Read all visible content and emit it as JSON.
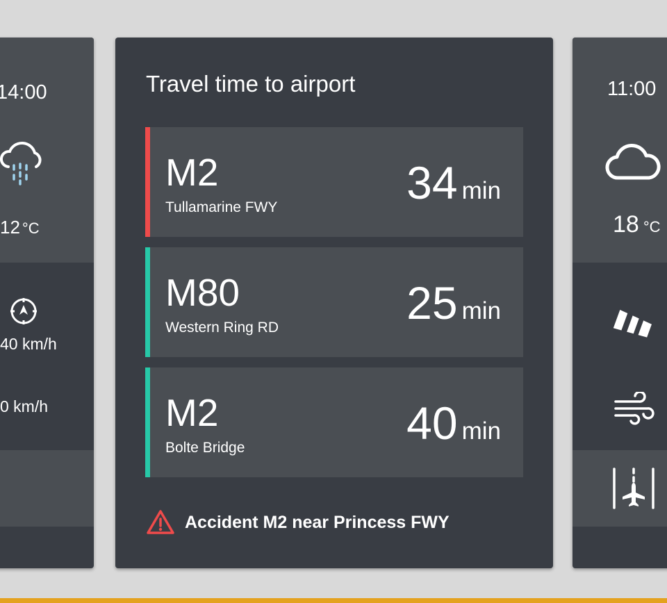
{
  "left_card": {
    "time": "14:00",
    "weather_icon": "rain-cloud-icon",
    "temperature": "12",
    "temperature_unit": "°C",
    "wind_icon": "compass-icon",
    "wind_speed": "40 km/h",
    "gust_speed": "0 km/h"
  },
  "center_card": {
    "title": "Travel time to airport",
    "routes": [
      {
        "code": "M2",
        "road": "Tullamarine FWY",
        "minutes": "34",
        "unit": "min",
        "status_color": "#ef4b4b"
      },
      {
        "code": "M80",
        "road": "Western Ring RD",
        "minutes": "25",
        "unit": "min",
        "status_color": "#27c9a8"
      },
      {
        "code": "M2",
        "road": "Bolte Bridge",
        "minutes": "40",
        "unit": "min",
        "status_color": "#27c9a8"
      }
    ],
    "alert": {
      "icon": "warning-triangle-icon",
      "text": "Accident M2 near Princess FWY",
      "color": "#ef4b4b"
    }
  },
  "right_card": {
    "time": "11:00",
    "weather_icon": "cloud-icon",
    "temperature": "18",
    "temperature_unit": "°C",
    "windsock_icon": "windsock-icon",
    "wind_icon": "wind-lines-icon",
    "runway_icon": "runway-airplane-icon"
  },
  "colors": {
    "background": "#d9d9d9",
    "card": "#393d44",
    "panel": "#4a4e53",
    "accent_stripe": "#e4a21f"
  }
}
